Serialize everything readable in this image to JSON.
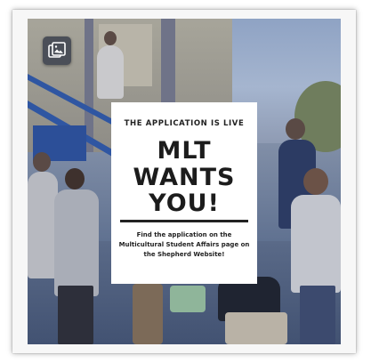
{
  "post": {
    "media_type_icon": "image-icon",
    "subhead": "THE APPLICATION IS LIVE",
    "headline": [
      "MLT",
      "WANTS",
      "YOU!"
    ],
    "body": "Find the application on the Multicultural Student Affairs page on the Shepherd Website!"
  }
}
